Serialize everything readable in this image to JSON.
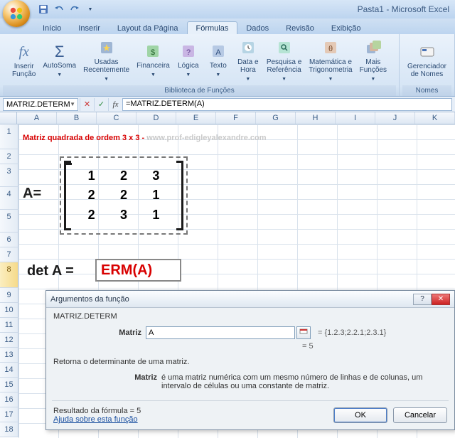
{
  "title_right": "Pasta1 - Microsoft Excel",
  "tabs": {
    "inicio": "Início",
    "inserir": "Inserir",
    "layout": "Layout da Página",
    "formulas": "Fórmulas",
    "dados": "Dados",
    "revisao": "Revisão",
    "exibicao": "Exibição"
  },
  "ribbon": {
    "inserir_funcao": "Inserir\nFunção",
    "autosoma": "AutoSoma",
    "usadas": "Usadas\nRecentemente",
    "financeira": "Financeira",
    "logica": "Lógica",
    "texto": "Texto",
    "data": "Data e\nHora",
    "pesquisa": "Pesquisa e\nReferência",
    "mat": "Matemática e\nTrigonometria",
    "mais": "Mais\nFunções",
    "lib_caption": "Biblioteca de Funções",
    "gerenciador": "Gerenciador\nde Nomes",
    "nomes_caption": "Nomes"
  },
  "namebox": "MATRIZ.DETERM",
  "formula_bar": "=MATRIZ.DETERM(A)",
  "cols": [
    "A",
    "B",
    "C",
    "D",
    "E",
    "F",
    "G",
    "H",
    "I",
    "J",
    "K"
  ],
  "rows": [
    "1",
    "2",
    "3",
    "4",
    "5",
    "6",
    "7",
    "8",
    "9",
    "10",
    "11",
    "12",
    "13",
    "14",
    "15",
    "16",
    "17",
    "18"
  ],
  "content": {
    "heading": "Matriz quadrada de ordem 3 x 3 - ",
    "watermark": "www.prof-edigleyalexandre.com",
    "Aeq": "A=",
    "matrix": {
      "r0": [
        "1",
        "2",
        "3"
      ],
      "r1": [
        "2",
        "2",
        "1"
      ],
      "r2": [
        "2",
        "3",
        "1"
      ]
    },
    "detA": "det A =",
    "detCellText": "ERM(A)"
  },
  "dialog": {
    "title": "Argumentos da função",
    "func_name": "MATRIZ.DETERM",
    "arg_label": "Matriz",
    "arg_value": "A",
    "arg_preview": "= {1.2.3;2.2.1;2.3.1}",
    "result_eq": "= 5",
    "description": "Retorna o determinante de uma matriz.",
    "arg_desc_label": "Matriz",
    "arg_desc": "é uma matriz numérica com um mesmo número de linhas e de colunas, um intervalo de células ou uma constante de matriz.",
    "result_label": "Resultado da fórmula =  5",
    "help_link": "Ajuda sobre esta função",
    "ok": "OK",
    "cancel": "Cancelar"
  }
}
